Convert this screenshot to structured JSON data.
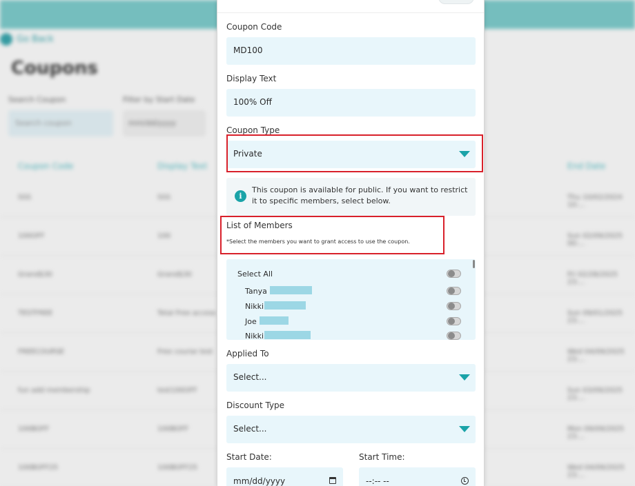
{
  "background": {
    "back_label": "Go Back",
    "page_title": "Coupons",
    "search_label": "Search Coupon",
    "search_placeholder": "Search coupon",
    "filter_label": "Filter by Start Date",
    "date_placeholder": "mm/dd/yyyy",
    "headers": [
      "Coupon Code",
      "Display Text",
      "End Date"
    ],
    "rows": [
      {
        "code": "SSS",
        "text": "SSS",
        "end": "Thu 10/02/2024 10:..."
      },
      {
        "code": "100OFF",
        "text": "100",
        "end": "Sun 02/09/2025 00:..."
      },
      {
        "code": "Grand$30",
        "text": "Grand$30",
        "end": "Fri 02/28/2025 23:..."
      },
      {
        "code": "TESTFREE",
        "text": "Total Free access",
        "end": "Sun 09/01/2025 23:..."
      },
      {
        "code": "FREECOURSE",
        "text": "Free course test",
        "end": "Wed 04/09/2025 23:..."
      },
      {
        "code": "fun add membership",
        "text": "test100OFF",
        "end": "Sun 03/09/2025 23:..."
      },
      {
        "code": "100BOFF",
        "text": "100BOFF",
        "end": "Mon 09/09/2025 23:..."
      },
      {
        "code": "100BOFF25",
        "text": "100BOFF25",
        "end": "Wed 04/09/2025 23:..."
      }
    ]
  },
  "form": {
    "coupon_code_label": "Coupon Code",
    "coupon_code_value": "MD100",
    "display_text_label": "Display Text",
    "display_text_value": "100% Off",
    "coupon_type_label": "Coupon Type",
    "coupon_type_value": "Private",
    "info_icon_glyph": "i",
    "info_text": "This coupon is available for public. If you want to restrict it to specific members, select below.",
    "members_title": "List of Members",
    "members_note": "*Select the members you want to grant access to use the coupon.",
    "select_all_label": "Select All",
    "members": [
      {
        "name": "Tanya"
      },
      {
        "name": "Nikki"
      },
      {
        "name": "Joe"
      },
      {
        "name": "Nikki"
      }
    ],
    "applied_to_label": "Applied To",
    "applied_to_value": "Select...",
    "discount_type_label": "Discount Type",
    "discount_type_value": "Select...",
    "start_date_label": "Start Date:",
    "start_date_placeholder": "mm/dd/yyyy",
    "start_time_label": "Start Time:",
    "start_time_placeholder": "--:-- --"
  },
  "colors": {
    "accent": "#1aa3a8",
    "field_bg": "#e8f6fb",
    "highlight_box": "#d8202a"
  }
}
